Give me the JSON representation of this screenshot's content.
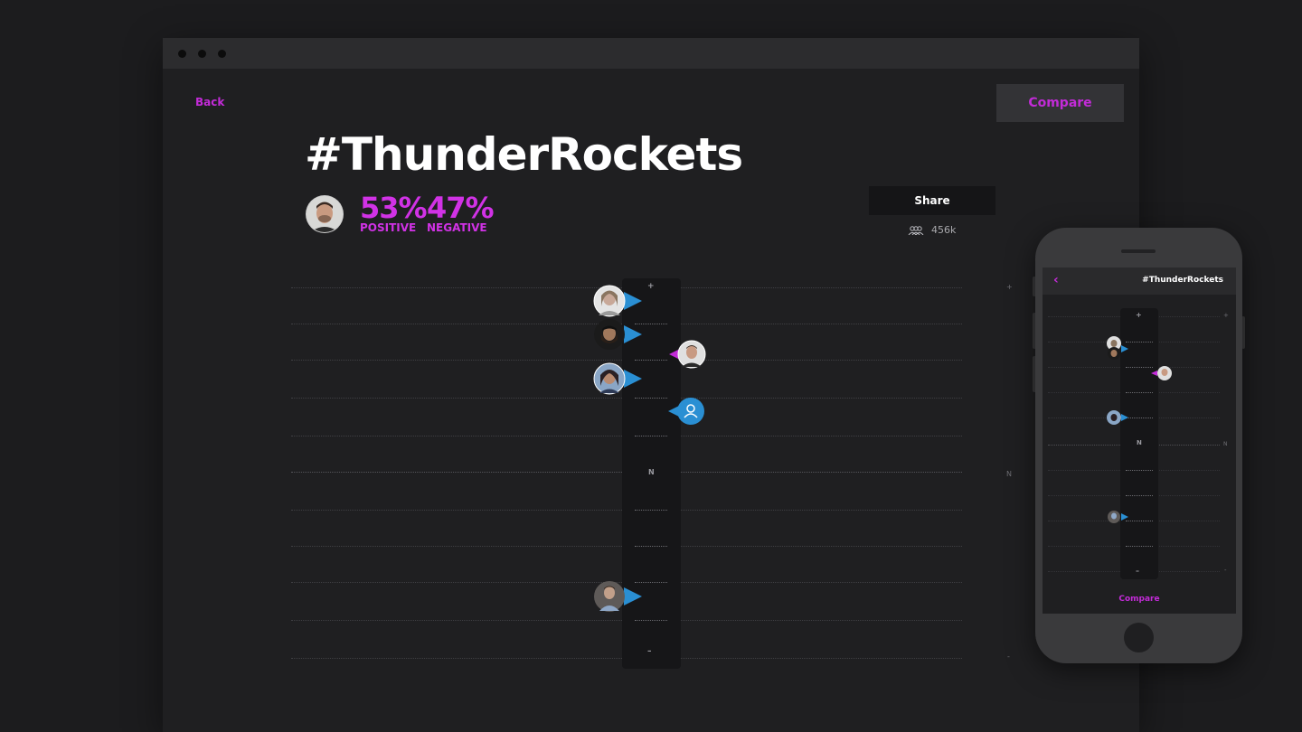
{
  "window": {
    "controls": [
      "close",
      "minimize",
      "maximize"
    ]
  },
  "nav": {
    "back_label": "Back",
    "compare_label": "Compare"
  },
  "hashtag": {
    "title": "#ThunderRockets"
  },
  "sentiment": {
    "positive_pct": "53%",
    "positive_label": "POSITIVE",
    "negative_pct": "47%",
    "negative_label": "NEGATIVE"
  },
  "share": {
    "label": "Share",
    "followers_count": "456k",
    "followers_icon": "people-icon"
  },
  "scale": {
    "top_label": "+",
    "middle_label": "N",
    "bottom_label": "–",
    "right_top_label": "+",
    "right_middle_label": "N",
    "right_bottom_label": "-"
  },
  "markers": [
    {
      "side": "left",
      "type": "photo",
      "tone": "light"
    },
    {
      "side": "left",
      "type": "photo",
      "tone": "dark"
    },
    {
      "side": "right",
      "type": "photo",
      "tone": "light"
    },
    {
      "side": "left",
      "type": "photo",
      "tone": "medium"
    },
    {
      "side": "right",
      "type": "user-icon",
      "tone": "blue"
    },
    {
      "side": "left",
      "type": "photo",
      "tone": "medium"
    }
  ],
  "mobile": {
    "back_icon": "chevron-left-icon",
    "title": "#ThunderRockets",
    "compare_label": "Compare",
    "top_label": "+",
    "middle_label": "N",
    "bottom_label": "–",
    "right_top_label": "+",
    "right_middle_label": "N",
    "right_bottom_label": "-"
  },
  "colors": {
    "accent": "#c32bd8",
    "marker_blue": "#2a8fd3",
    "marker_pink": "#c32bd8",
    "background": "#1c1c1e"
  }
}
